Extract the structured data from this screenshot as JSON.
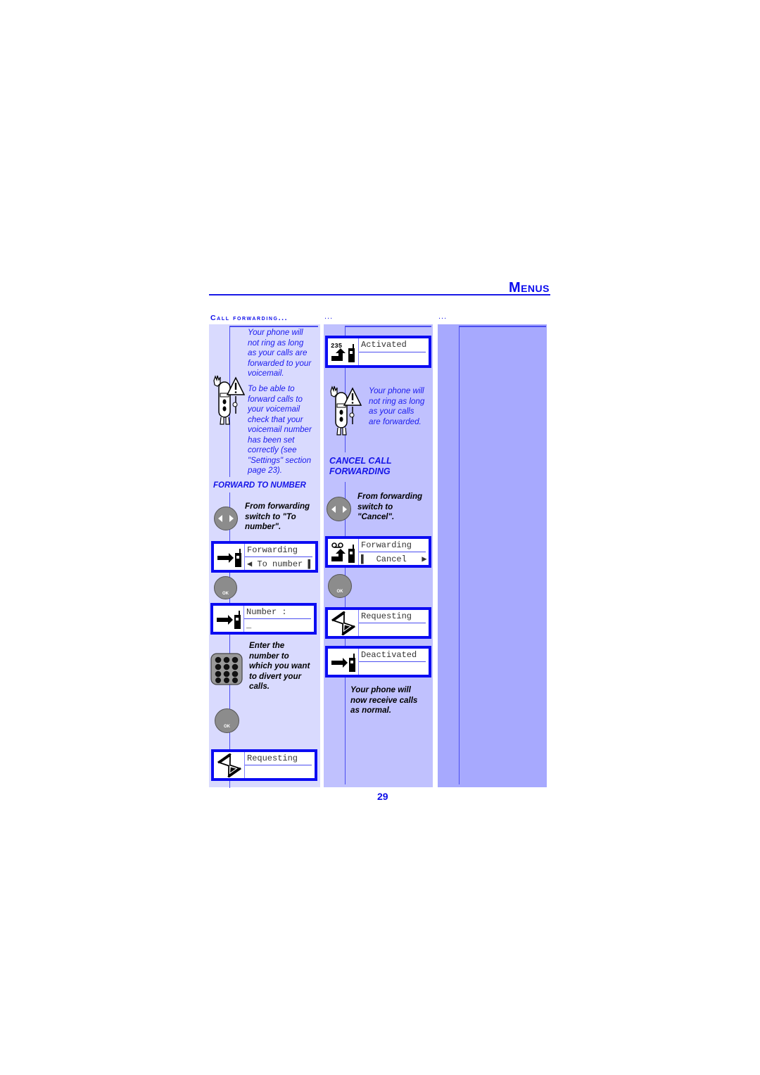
{
  "header": {
    "title": "Menus"
  },
  "section": {
    "title": "Call forwarding...",
    "continuation_1": "...",
    "continuation_2": "..."
  },
  "column1": {
    "note_1": [
      "Your phone will",
      "not ring as long",
      "as your calls are",
      "forwarded to your",
      "voicemail."
    ],
    "note_2": [
      "To be able to",
      "forward calls to",
      "your voicemail",
      "check that your",
      "voicemail number",
      "has been set",
      "correctly (see",
      "\"Settings\" section",
      "page 23)."
    ],
    "subheading": "FORWARD TO NUMBER",
    "step_1": [
      "From forwarding",
      "switch to \"To",
      "number\"."
    ],
    "screen_1": {
      "line_1": "Forwarding",
      "line_2": "◀ To number ▌"
    },
    "screen_2": {
      "line_1": "Number :",
      "line_2": "_"
    },
    "step_2": [
      "Enter the",
      "number to",
      "which you want",
      "to divert your",
      "calls."
    ],
    "screen_3": {
      "line_1": "Requesting",
      "line_2": ""
    },
    "key_ok_label": "OK"
  },
  "column2": {
    "screen_1": {
      "line_1": "Activated",
      "line_2": "",
      "icon_digits": "235"
    },
    "note_1": [
      "Your phone will",
      "not ring as long",
      "as your calls",
      "are forwarded."
    ],
    "subheading": [
      "CANCEL CALL",
      "FORWARDING"
    ],
    "step_1": [
      "From forwarding",
      "switch to",
      "\"Cancel\"."
    ],
    "screen_2": {
      "line_1": "Forwarding",
      "line_2": "▌  Cancel   ▶"
    },
    "screen_3": {
      "line_1": "Requesting",
      "line_2": ""
    },
    "screen_4": {
      "line_1": "Deactivated",
      "line_2": ""
    },
    "step_2": [
      "Your phone will",
      "now receive calls",
      "as normal."
    ],
    "key_ok_label": "OK"
  },
  "footer": {
    "page_number": "29"
  },
  "colors": {
    "accent": "#0c0cf2",
    "col1_bg": "#d9dafe",
    "col2_bg": "#c0c1fe",
    "col3_bg": "#a7a9fe"
  }
}
